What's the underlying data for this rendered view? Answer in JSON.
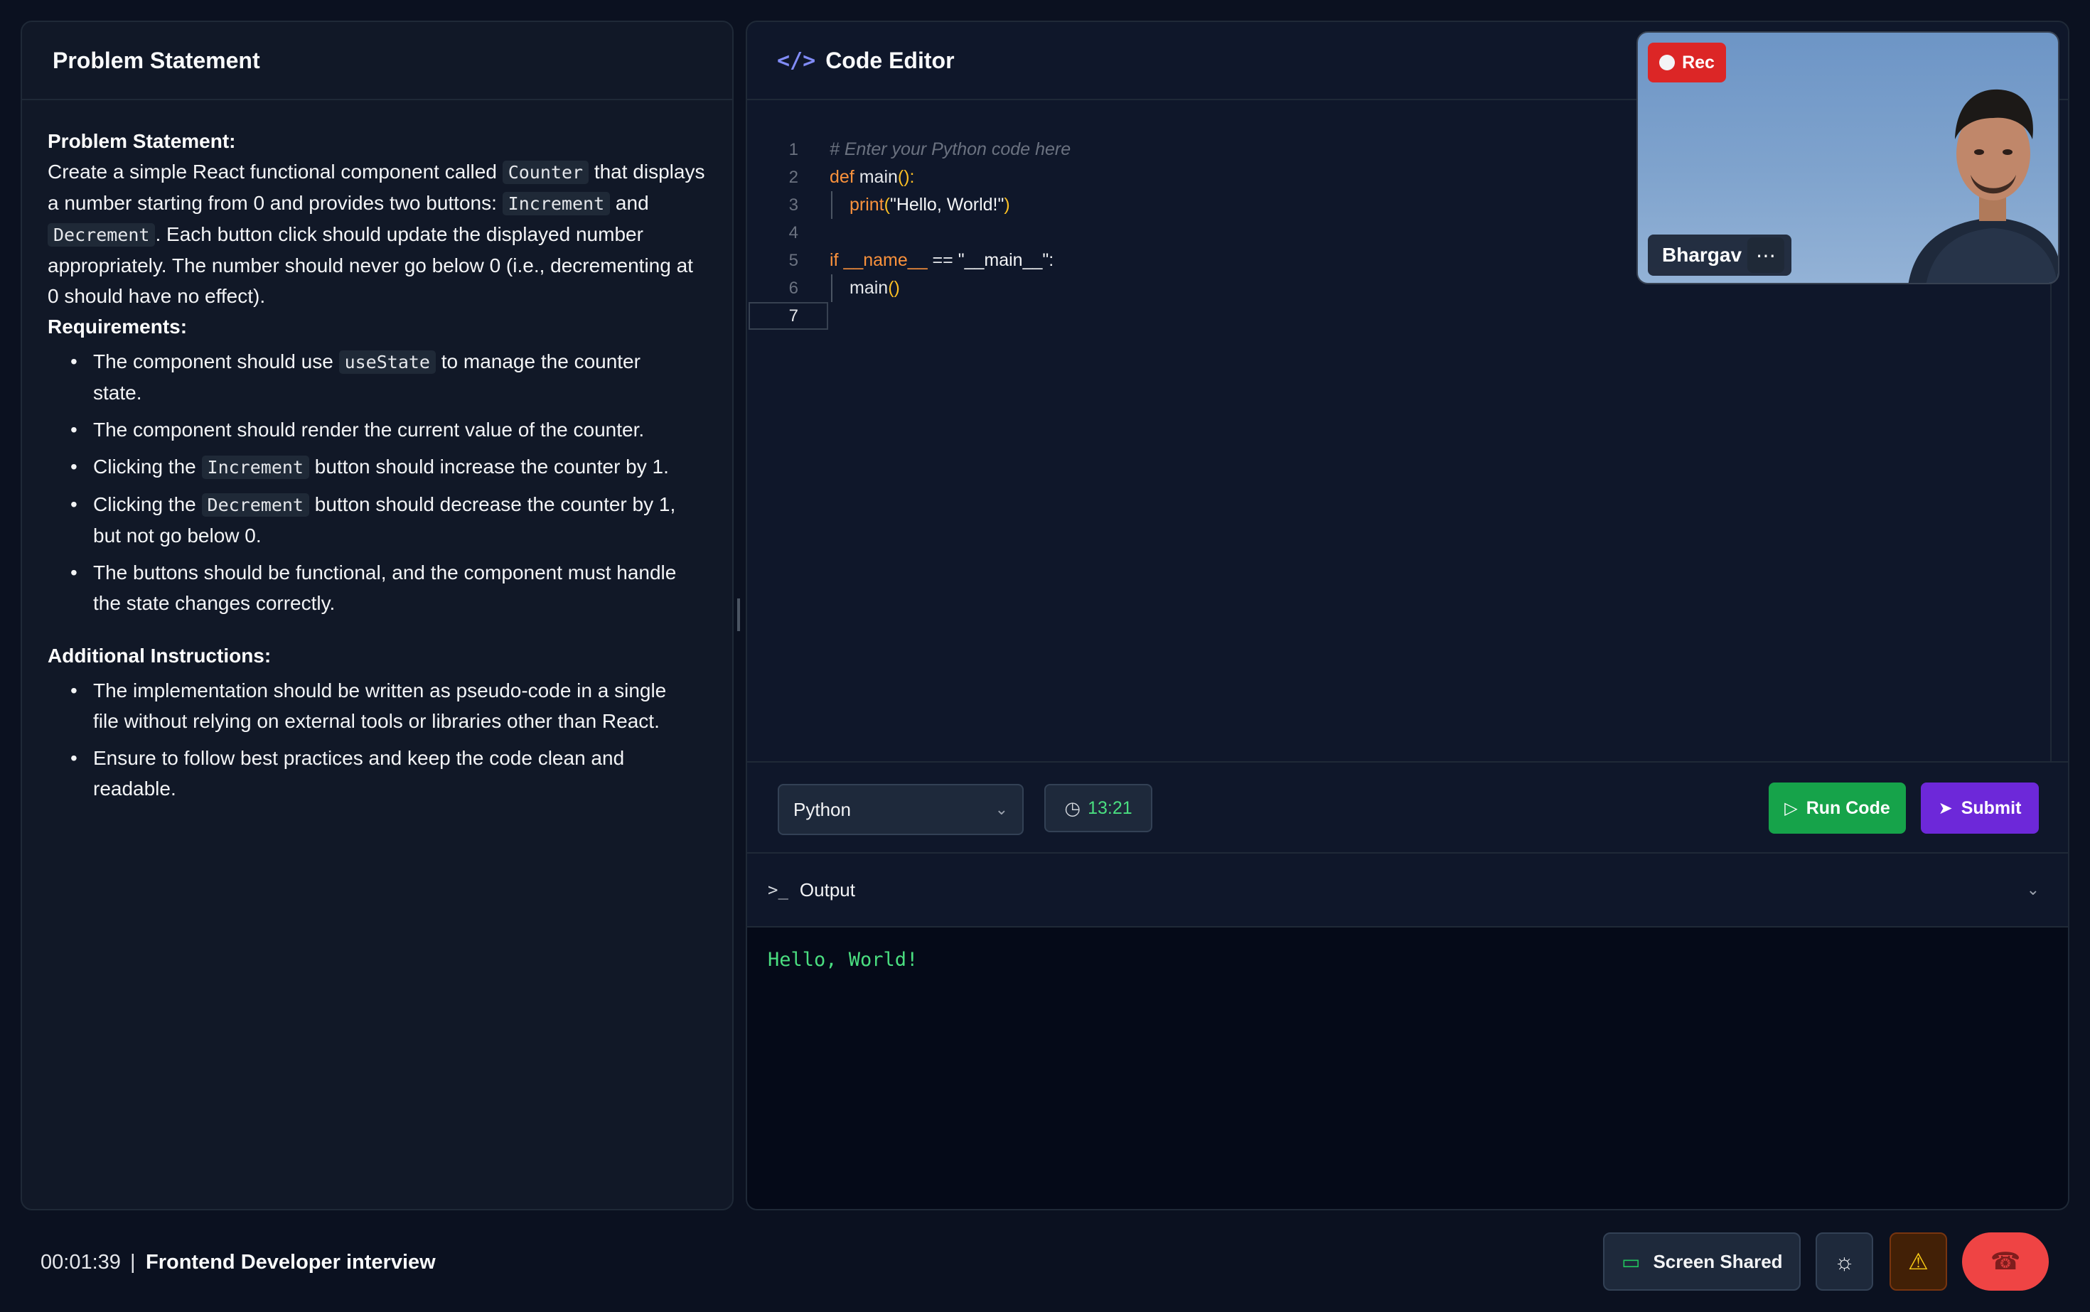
{
  "left_panel": {
    "title": "Problem Statement",
    "heading": "Problem Statement:",
    "intro": {
      "t1": "Create a simple React functional component called ",
      "c1": "Counter",
      "t2": " that displays a number starting from 0 and provides two buttons: ",
      "c2": "Increment",
      "t3": " and ",
      "c3": "Decrement",
      "t4": ". Each button click should update the displayed number appropriately. The number should never go below 0 (i.e., decrementing at 0 should have no effect)."
    },
    "requirements_heading": "Requirements:",
    "requirements": {
      "r1a": "The component should use ",
      "r1c": "useState",
      "r1b": " to manage the counter state.",
      "r2": "The component should render the current value of the counter.",
      "r3a": "Clicking the ",
      "r3c": "Increment",
      "r3b": " button should increase the counter by 1.",
      "r4a": "Clicking the ",
      "r4c": "Decrement",
      "r4b": " button should decrease the counter by 1, but not go below 0.",
      "r5": "The buttons should be functional, and the component must handle the state changes correctly."
    },
    "additional_heading": "Additional Instructions:",
    "additional": {
      "a1": "The implementation should be written as pseudo-code in a single file without relying on external tools or libraries other than React.",
      "a2": "Ensure to follow best practices and keep the code clean and readable."
    }
  },
  "editor": {
    "title": "Code Editor",
    "code_icon": "code-icon",
    "lines": {
      "n1": "1",
      "n2": "2",
      "n3": "3",
      "n4": "4",
      "n5": "5",
      "n6": "6",
      "n7": "7",
      "l1": "# Enter your Python code here",
      "l2_kw": "def",
      "l2_fn": " main",
      "l2_p": "():",
      "l3_fn": "print",
      "l3_p1": "(",
      "l3_str": "\"Hello, World!\"",
      "l3_p2": ")",
      "l5_kw": "if",
      "l5_dn": " __name__",
      "l5_op": " == ",
      "l5_str": "\"__main__\":",
      "l6_fn": "main",
      "l6_p": "()"
    },
    "language": "Python",
    "timer": "13:21",
    "run_label": "Run Code",
    "submit_label": "Submit",
    "output_label": "Output",
    "output_text": "Hello, World!"
  },
  "video": {
    "rec_label": "Rec",
    "participant_name": "Bhargav",
    "more_label": "⋯"
  },
  "bottom_bar": {
    "elapsed": "00:01:39",
    "separator": "|",
    "session_title": "Frontend Developer interview",
    "screen_share_label": "Screen Shared"
  },
  "colors": {
    "background": "#0b1120",
    "run_button": "#16a34a",
    "submit_button": "#6d28d9",
    "end_call": "#ef4444",
    "rec": "#dc2626",
    "output_text": "#4ade80"
  }
}
